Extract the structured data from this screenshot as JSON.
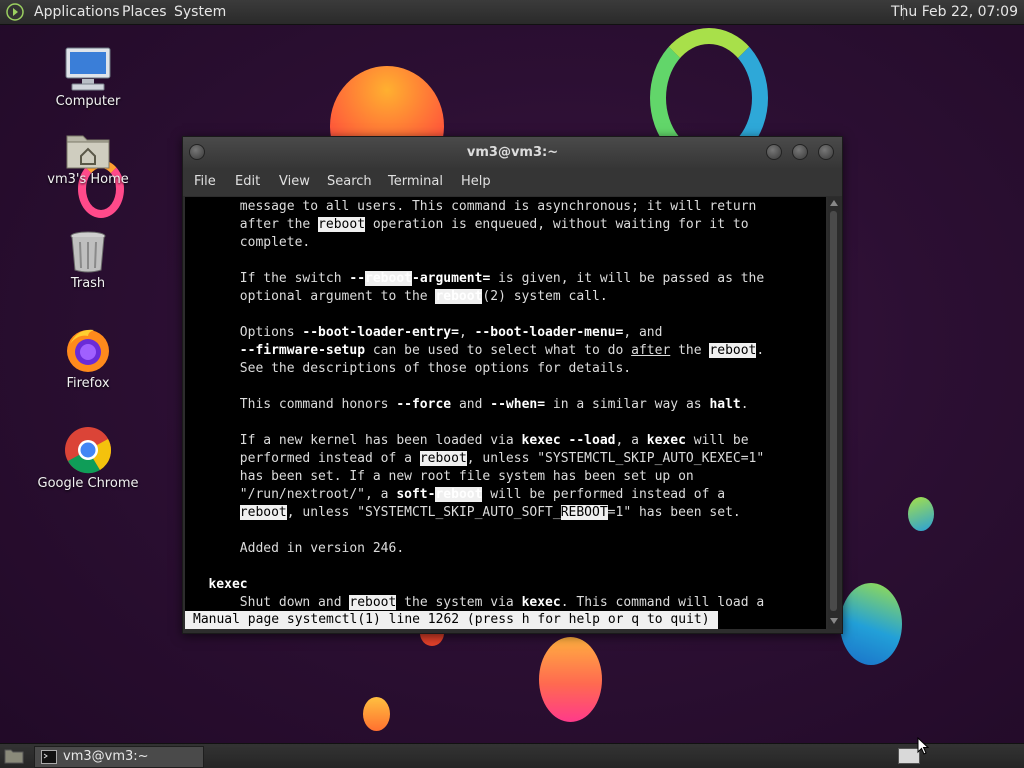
{
  "top_panel": {
    "menu_applications": "Applications",
    "menu_places": "Places",
    "menu_system": "System",
    "clock": "Thu Feb 22, 07:09"
  },
  "desktop_icons": [
    {
      "label": "Computer"
    },
    {
      "label": "vm3's Home"
    },
    {
      "label": "Trash"
    },
    {
      "label": "Firefox"
    },
    {
      "label": "Google Chrome"
    }
  ],
  "terminal": {
    "title": "vm3@vm3:~",
    "menu": [
      "File",
      "Edit",
      "View",
      "Search",
      "Terminal",
      "Help"
    ],
    "lines": [
      [
        {
          "t": "       message to all users. This command is asynchronous; it will return"
        }
      ],
      [
        {
          "t": "       after the "
        },
        {
          "t": "reboot",
          "c": "hl"
        },
        {
          "t": " operation is enqueued, without waiting for it to"
        }
      ],
      [
        {
          "t": "       complete."
        }
      ],
      [
        {
          "t": ""
        }
      ],
      [
        {
          "t": "       If the switch "
        },
        {
          "t": "--",
          "c": "b"
        },
        {
          "t": "reboot",
          "c": "hl b"
        },
        {
          "t": "-argument=",
          "c": "b"
        },
        {
          "t": " is given, it will be passed as the"
        }
      ],
      [
        {
          "t": "       optional argument to the "
        },
        {
          "t": "reboot",
          "c": "hl b"
        },
        {
          "t": "(2) system call."
        }
      ],
      [
        {
          "t": ""
        }
      ],
      [
        {
          "t": "       Options "
        },
        {
          "t": "--boot-loader-entry=",
          "c": "b"
        },
        {
          "t": ", "
        },
        {
          "t": "--boot-loader-menu=",
          "c": "b"
        },
        {
          "t": ", and"
        }
      ],
      [
        {
          "t": "       "
        },
        {
          "t": "--firmware-setup",
          "c": "b"
        },
        {
          "t": " can be used to select what to do "
        },
        {
          "t": "after",
          "c": "u"
        },
        {
          "t": " the "
        },
        {
          "t": "reboot",
          "c": "hl"
        },
        {
          "t": "."
        }
      ],
      [
        {
          "t": "       See the descriptions of those options for details."
        }
      ],
      [
        {
          "t": ""
        }
      ],
      [
        {
          "t": "       This command honors "
        },
        {
          "t": "--force",
          "c": "b"
        },
        {
          "t": " and "
        },
        {
          "t": "--when=",
          "c": "b"
        },
        {
          "t": " in a similar way as "
        },
        {
          "t": "halt",
          "c": "b"
        },
        {
          "t": "."
        }
      ],
      [
        {
          "t": ""
        }
      ],
      [
        {
          "t": "       If a new kernel has been loaded via "
        },
        {
          "t": "kexec --load",
          "c": "b"
        },
        {
          "t": ", a "
        },
        {
          "t": "kexec",
          "c": "b"
        },
        {
          "t": " will be"
        }
      ],
      [
        {
          "t": "       performed instead of a "
        },
        {
          "t": "reboot",
          "c": "hl"
        },
        {
          "t": ", unless \"SYSTEMCTL_SKIP_AUTO_KEXEC=1\""
        }
      ],
      [
        {
          "t": "       has been set. If a new root file system has been set up on"
        }
      ],
      [
        {
          "t": "       \"/run/nextroot/\", a "
        },
        {
          "t": "soft-",
          "c": "b"
        },
        {
          "t": "reboot",
          "c": "hl b"
        },
        {
          "t": " will be performed instead of a"
        }
      ],
      [
        {
          "t": "       "
        },
        {
          "t": "reboot",
          "c": "hl"
        },
        {
          "t": ", unless \"SYSTEMCTL_SKIP_AUTO_SOFT_"
        },
        {
          "t": "REBOOT",
          "c": "hl"
        },
        {
          "t": "=1\" has been set."
        }
      ],
      [
        {
          "t": ""
        }
      ],
      [
        {
          "t": "       Added in version 246."
        }
      ],
      [
        {
          "t": ""
        }
      ],
      [
        {
          "t": "   "
        },
        {
          "t": "kexec",
          "c": "b"
        }
      ],
      [
        {
          "t": "       Shut down and "
        },
        {
          "t": "reboot",
          "c": "hl"
        },
        {
          "t": " the system via "
        },
        {
          "t": "kexec",
          "c": "b"
        },
        {
          "t": ". This command will load a"
        }
      ]
    ],
    "status_line": "Manual page systemctl(1) line 1262 (press h for help or q to quit)"
  },
  "bottom_panel": {
    "task_label": "vm3@vm3:~"
  }
}
